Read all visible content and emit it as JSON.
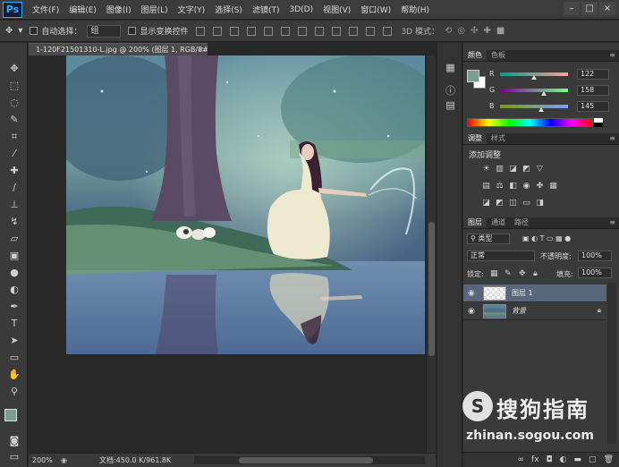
{
  "app": {
    "logo": "Ps"
  },
  "menu": [
    "文件(F)",
    "编辑(E)",
    "图像(I)",
    "图层(L)",
    "文字(Y)",
    "选择(S)",
    "滤镜(T)",
    "3D(D)",
    "视图(V)",
    "窗口(W)",
    "帮助(H)"
  ],
  "window_buttons": [
    "–",
    "□",
    "×"
  ],
  "options": {
    "auto_select_label": "自动选择：",
    "auto_select_value": "组",
    "show_transform_label": "显示变换控件",
    "mode_label": "3D 模式："
  },
  "document": {
    "tab_title": "1-120F21501310-L.jpg @ 200% (图层 1, RGB/8#) *",
    "close": "×"
  },
  "status": {
    "zoom": "200%",
    "doc_info": "文档:450.0 K/961.8K"
  },
  "color_panel": {
    "tabs": [
      "颜色",
      "色板"
    ],
    "channels": [
      {
        "letter": "R",
        "value": "122"
      },
      {
        "letter": "G",
        "value": "158"
      },
      {
        "letter": "B",
        "value": "145"
      }
    ],
    "fg_color": "#7a9e91"
  },
  "adjustments_panel": {
    "tabs": [
      "调整",
      "样式"
    ],
    "title": "添加调整"
  },
  "layers_panel": {
    "tabs": [
      "图层",
      "通道",
      "路径"
    ],
    "filter_kind": "类型",
    "blend_mode": "正常",
    "opacity_label": "不透明度:",
    "opacity_value": "100%",
    "lock_label": "锁定:",
    "fill_label": "填充:",
    "fill_value": "100%",
    "layers": [
      {
        "name": "图层 1",
        "selected": true
      },
      {
        "name": "背景",
        "selected": false,
        "locked": true
      }
    ]
  },
  "watermark": {
    "name": "搜狗指南",
    "url": "zhinan.sogou.com",
    "logo": "S"
  }
}
